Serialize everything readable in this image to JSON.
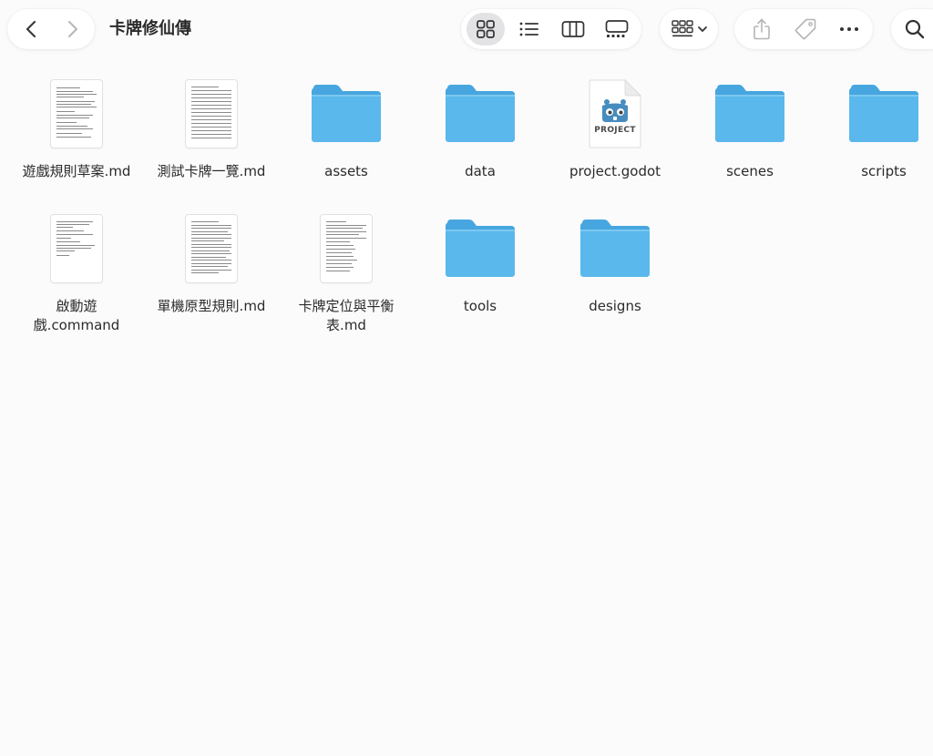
{
  "toolbar": {
    "title": "卡牌修仙傳",
    "back": "back",
    "forward": "forward",
    "views": [
      "icon view",
      "list view",
      "column view",
      "gallery view"
    ],
    "group": "group by",
    "share": "share",
    "tags": "tags",
    "more": "more",
    "search": "search"
  },
  "items": [
    {
      "name": "遊戲規則草案.md",
      "kind": "document"
    },
    {
      "name": "測試卡牌一覽.md",
      "kind": "document"
    },
    {
      "name": "assets",
      "kind": "folder"
    },
    {
      "name": "data",
      "kind": "folder"
    },
    {
      "name": "project.godot",
      "kind": "godot",
      "badge": "PROJECT"
    },
    {
      "name": "scenes",
      "kind": "folder"
    },
    {
      "name": "scripts",
      "kind": "folder"
    },
    {
      "name": "啟動遊戲.command",
      "kind": "document"
    },
    {
      "name": "單機原型規則.md",
      "kind": "document"
    },
    {
      "name": "卡牌定位與平衡表.md",
      "kind": "document"
    },
    {
      "name": "tools",
      "kind": "folder"
    },
    {
      "name": "designs",
      "kind": "folder"
    }
  ],
  "colors": {
    "folder_front": "#5ab8ec",
    "folder_back": "#47a6df",
    "godot_blue": "#478cbf",
    "text": "#2b2b2b"
  }
}
